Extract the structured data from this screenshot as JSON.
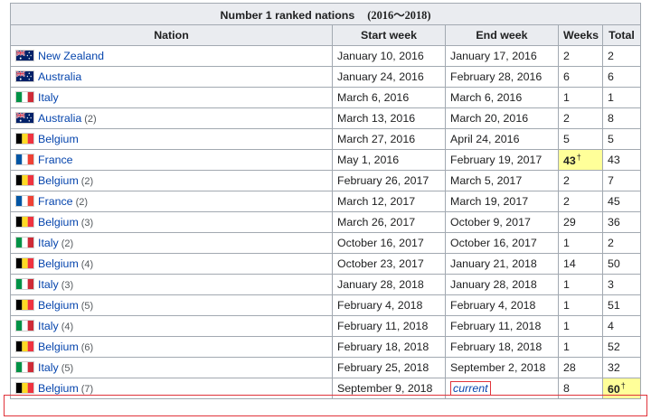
{
  "caption": {
    "title": "Number 1 ranked nations",
    "years": "(2016～2018)"
  },
  "headers": {
    "nation": "Nation",
    "start": "Start week",
    "end": "End week",
    "weeks": "Weeks",
    "total": "Total"
  },
  "colors": {
    "link": "#0645ad",
    "header_bg": "#eaecf0",
    "border": "#a2a9b1",
    "highlight": "#ffff99",
    "annotation": "#e0333a"
  },
  "rows": [
    {
      "flag": "australia-nz-flag",
      "nation": "New Zealand",
      "count": "",
      "start": "January 10, 2016",
      "end": "January 17, 2016",
      "weeks": "2",
      "total": "2"
    },
    {
      "flag": "australia-nz-flag",
      "nation": "Australia",
      "count": "",
      "start": "January 24, 2016",
      "end": "February 28, 2016",
      "weeks": "6",
      "total": "6"
    },
    {
      "flag": "italy-flag",
      "nation": "Italy",
      "count": "",
      "start": "March 6, 2016",
      "end": "March 6, 2016",
      "weeks": "1",
      "total": "1"
    },
    {
      "flag": "australia-nz-flag",
      "nation": "Australia",
      "count": "(2)",
      "start": "March 13, 2016",
      "end": "March 20, 2016",
      "weeks": "2",
      "total": "8"
    },
    {
      "flag": "belgium-flag",
      "nation": "Belgium",
      "count": "",
      "start": "March 27, 2016",
      "end": "April 24, 2016",
      "weeks": "5",
      "total": "5"
    },
    {
      "flag": "france-flag",
      "nation": "France",
      "count": "",
      "start": "May 1, 2016",
      "end": "February 19, 2017",
      "weeks": "43",
      "weeks_mark": "†",
      "total": "43"
    },
    {
      "flag": "belgium-flag",
      "nation": "Belgium",
      "count": "(2)",
      "start": "February 26, 2017",
      "end": "March 5, 2017",
      "weeks": "2",
      "total": "7"
    },
    {
      "flag": "france-flag",
      "nation": "France",
      "count": "(2)",
      "start": "March 12, 2017",
      "end": "March 19, 2017",
      "weeks": "2",
      "total": "45"
    },
    {
      "flag": "belgium-flag",
      "nation": "Belgium",
      "count": "(3)",
      "start": "March 26, 2017",
      "end": "October 9, 2017",
      "weeks": "29",
      "total": "36"
    },
    {
      "flag": "italy-flag",
      "nation": "Italy",
      "count": "(2)",
      "start": "October 16, 2017",
      "end": "October 16, 2017",
      "weeks": "1",
      "total": "2"
    },
    {
      "flag": "belgium-flag",
      "nation": "Belgium",
      "count": "(4)",
      "start": "October 23, 2017",
      "end": "January 21, 2018",
      "weeks": "14",
      "total": "50"
    },
    {
      "flag": "italy-flag",
      "nation": "Italy",
      "count": "(3)",
      "start": "January 28, 2018",
      "end": "January 28, 2018",
      "weeks": "1",
      "total": "3"
    },
    {
      "flag": "belgium-flag",
      "nation": "Belgium",
      "count": "(5)",
      "start": "February 4, 2018",
      "end": "February 4, 2018",
      "weeks": "1",
      "total": "51"
    },
    {
      "flag": "italy-flag",
      "nation": "Italy",
      "count": "(4)",
      "start": "February 11, 2018",
      "end": "February 11, 2018",
      "weeks": "1",
      "total": "4"
    },
    {
      "flag": "belgium-flag",
      "nation": "Belgium",
      "count": "(6)",
      "start": "February 18, 2018",
      "end": "February 18, 2018",
      "weeks": "1",
      "total": "52"
    },
    {
      "flag": "italy-flag",
      "nation": "Italy",
      "count": "(5)",
      "start": "February 25, 2018",
      "end": "September 2, 2018",
      "weeks": "28",
      "total": "32"
    },
    {
      "flag": "belgium-flag",
      "nation": "Belgium",
      "count": "(7)",
      "start": "September 9, 2018",
      "end": "current",
      "weeks": "8",
      "total": "60",
      "total_mark": "†"
    }
  ]
}
